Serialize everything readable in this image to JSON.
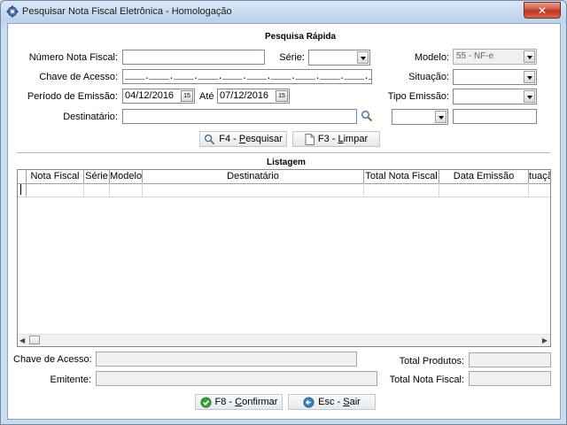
{
  "window": {
    "title": "Pesquisar Nota Fiscal Eletrônica - Homologação",
    "close_glyph": "✕"
  },
  "quick_search": {
    "title": "Pesquisa Rápida",
    "numero_label": "Número Nota Fiscal:",
    "numero_value": "",
    "serie_label": "Série:",
    "serie_value": "",
    "modelo_label": "Modelo:",
    "modelo_value": "55 - NF-e",
    "chave_label": "Chave de Acesso:",
    "chave_mask": "____.____.____.____.____.____.____.____.____.____.____",
    "situacao_label": "Situação:",
    "situacao_value": "",
    "periodo_label": "Período de Emissão:",
    "date_from": "04/12/2016",
    "ate_label": "Até",
    "date_to": "07/12/2016",
    "cal_glyph": "15",
    "tipo_label": "Tipo Emissão:",
    "tipo_value": "",
    "destinatario_label": "Destinatário:",
    "destinatario_value": "",
    "doc_type_value": "",
    "doc_number_value": ""
  },
  "actions": {
    "pesquisar_pre": "F4 - ",
    "pesquisar_key": "P",
    "pesquisar_post": "esquisar",
    "limpar_pre": "F3 - ",
    "limpar_key": "L",
    "limpar_post": "impar"
  },
  "listing": {
    "title": "Listagem",
    "columns": [
      "Nota Fiscal",
      "Série",
      "Modelo",
      "Destinatário",
      "Total Nota Fiscal",
      "Data Emissão",
      "tuaçã"
    ]
  },
  "footer": {
    "chave_label": "Chave de Acesso:",
    "chave_value": "",
    "emitente_label": "Emitente:",
    "emitente_value": "",
    "total_produtos_label": "Total Produtos:",
    "total_produtos_value": "",
    "total_nf_label": "Total Nota Fiscal:",
    "total_nf_value": "",
    "confirmar_pre": "F8 - ",
    "confirmar_key": "C",
    "confirmar_post": "onfirmar",
    "sair_pre": "Esc - ",
    "sair_key": "S",
    "sair_post": "air"
  },
  "colors": {
    "titlebar": "#c9dcf0",
    "close": "#c94a33",
    "confirm_icon": "#3aa13a",
    "exit_icon": "#3a7fc1"
  }
}
